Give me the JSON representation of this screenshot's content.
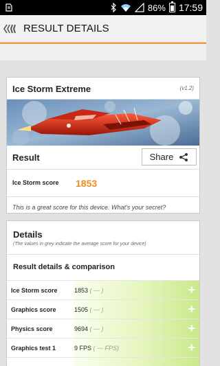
{
  "status_bar": {
    "battery_percent": "86%",
    "time": "17:59",
    "icons": [
      "notification-icon",
      "bluetooth-icon",
      "wifi-icon",
      "signal-icon",
      "battery-icon"
    ]
  },
  "app_bar": {
    "title": "RESULT DETAILS",
    "back_icon": "back-arrow-icon"
  },
  "summary_card": {
    "title": "Ice Storm Extreme",
    "version": "(v1.2)",
    "result_label": "Result",
    "share_label": "Share",
    "score_label": "Ice Storm score",
    "score_value": "1853",
    "comment": "This is a great score for this device. What's your secret?"
  },
  "details_card": {
    "title": "Details",
    "subtitle": "(The values in grey indicate the average score for your device)",
    "section_title": "Result details & comparison",
    "rows": [
      {
        "label": "Ice Storm score",
        "value": "1853",
        "average": "( --- )"
      },
      {
        "label": "Graphics score",
        "value": "1505",
        "average": "( --- )"
      },
      {
        "label": "Physics score",
        "value": "9694",
        "average": "( --- )"
      },
      {
        "label": "Graphics test 1",
        "value": "9 FPS",
        "average": "( --- FPS)"
      }
    ]
  },
  "colors": {
    "accent": "#f39a2e",
    "score": "#f08a1c",
    "bar_green": "#c9e98a"
  }
}
